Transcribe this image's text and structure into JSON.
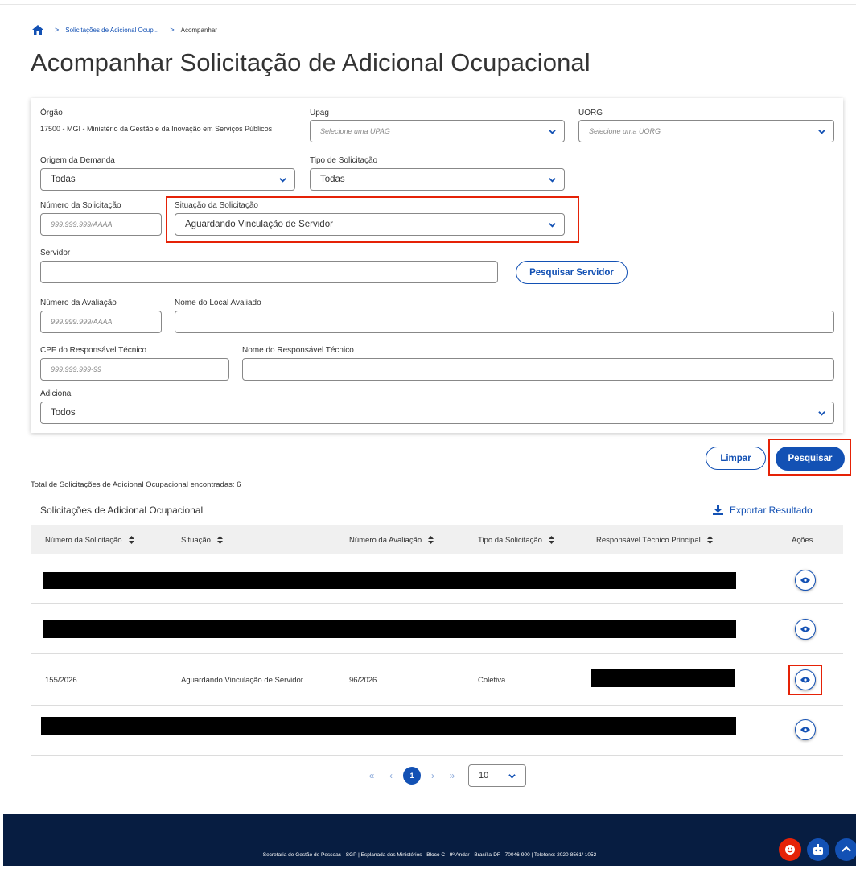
{
  "breadcrumb": {
    "items": [
      "Solicitações de Adicional Ocup...",
      "Acompanhar"
    ]
  },
  "page_title": "Acompanhar Solicitação de Adicional Ocupacional",
  "form": {
    "orgao": {
      "label": "Órgão",
      "value": "17500 - MGI - Ministério da Gestão e da Inovação em Serviços Públicos"
    },
    "upag": {
      "label": "Upag",
      "placeholder": "Selecione uma UPAG"
    },
    "uorg": {
      "label": "UORG",
      "placeholder": "Selecione uma UORG"
    },
    "origem": {
      "label": "Origem da Demanda",
      "value": "Todas"
    },
    "tipo": {
      "label": "Tipo de Solicitação",
      "value": "Todas"
    },
    "numero_solicitacao": {
      "label": "Número da Solicitação",
      "placeholder": "999.999.999/AAAA"
    },
    "situacao": {
      "label": "Situação da Solicitação",
      "value": "Aguardando Vinculação de Servidor"
    },
    "servidor": {
      "label": "Servidor",
      "value": ""
    },
    "pesquisar_servidor": "Pesquisar Servidor",
    "numero_avaliacao": {
      "label": "Número da Avaliação",
      "placeholder": "999.999.999/AAAA"
    },
    "local_avaliado": {
      "label": "Nome do Local Avaliado",
      "value": ""
    },
    "cpf_responsavel": {
      "label": "CPF do Responsável Técnico",
      "placeholder": "999.999.999-99"
    },
    "nome_responsavel": {
      "label": "Nome do Responsável Técnico",
      "value": ""
    },
    "adicional": {
      "label": "Adicional",
      "value": "Todos"
    }
  },
  "actions": {
    "limpar": "Limpar",
    "pesquisar": "Pesquisar"
  },
  "results": {
    "total_text": "Total de Solicitações de Adicional Ocupacional encontradas: 6",
    "table_title": "Solicitações de Adicional Ocupacional",
    "export_label": "Exportar Resultado",
    "columns": [
      "Número da Solicitação",
      "Situação",
      "Número da Avaliação",
      "Tipo da Solicitação",
      "Responsável Técnico Principal",
      "Ações"
    ],
    "rows": [
      {
        "numero": "",
        "situacao": "",
        "avaliacao": "",
        "tipo": "",
        "responsavel": "",
        "redacted": true
      },
      {
        "numero": "",
        "situacao": "",
        "avaliacao": "",
        "tipo": "",
        "responsavel": "",
        "redacted": true
      },
      {
        "numero": "155/2026",
        "situacao": "Aguardando Vinculação de Servidor",
        "avaliacao": "96/2026",
        "tipo": "Coletiva",
        "responsavel": "",
        "redacted": false
      },
      {
        "numero": "",
        "situacao": "",
        "avaliacao": "",
        "tipo": "",
        "responsavel": "",
        "redacted": true
      }
    ]
  },
  "pagination": {
    "current_page": "1",
    "page_size": "10"
  },
  "footer": {
    "text": "Secretaria de Gestão de Pessoas - SGP | Esplanada dos Ministérios - Bloco C - 9º Andar - Brasília-DF - 70046-900 | Telefone: 2020-8561/ 1052"
  },
  "colors": {
    "primary": "#1351b4",
    "footer_bg": "#071d41",
    "highlight": "#e52207"
  },
  "icons": [
    "home-icon",
    "chevron-down-icon",
    "sort-icon",
    "download-icon",
    "eye-icon",
    "smiley-icon",
    "robot-icon",
    "chevron-up-icon"
  ]
}
